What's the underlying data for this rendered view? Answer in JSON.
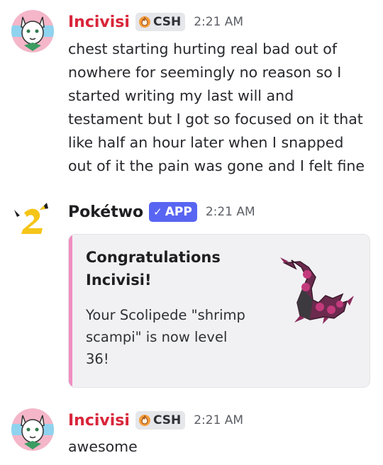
{
  "messages": [
    {
      "username": "Incivisi",
      "tag": "CSH",
      "time": "2:21 AM",
      "text": "chest starting hurting real bad out of nowhere for seemingly no reason so I started writing my last will and testament but I got so focused on it that like half an hour later when I snapped out of it the pain was gone and I felt fine"
    },
    {
      "username": "Pokétwo",
      "tag": "APP",
      "time": "2:21 AM",
      "embed": {
        "title": "Congratulations Incivisi!",
        "description": "Your Scolipede \"shrimp scampi\" is now level 36!",
        "accent_color": "#f08ec0"
      }
    },
    {
      "username": "Incivisi",
      "tag": "CSH",
      "time": "2:21 AM",
      "text": "awesome"
    }
  ],
  "colors": {
    "username_user": "#d9253a",
    "app_badge": "#5865f2"
  },
  "icons": {
    "guild_tag": "flame-badge-icon",
    "app_check": "check-icon",
    "bot_avatar": "poketwo-logo-icon",
    "embed_thumbnail": "scolipede-image"
  }
}
